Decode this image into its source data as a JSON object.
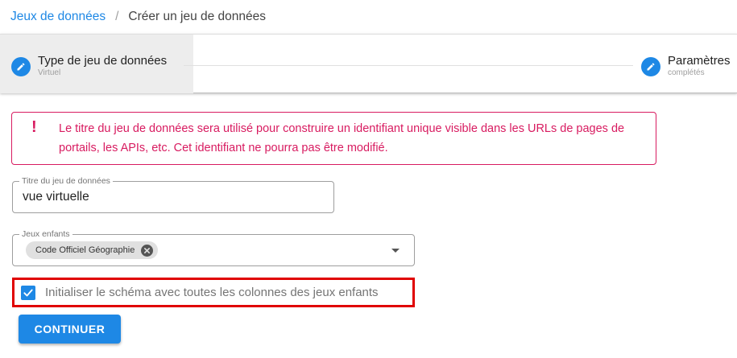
{
  "breadcrumb": {
    "link_label": "Jeux de données",
    "separator": "/",
    "current_label": "Créer un jeu de données"
  },
  "stepper": {
    "steps": [
      {
        "title": "Type de jeu de données",
        "subtitle": "Virtuel",
        "icon": "pencil-icon",
        "active": true
      },
      {
        "title": "Paramètres",
        "subtitle": "complétés",
        "icon": "pencil-icon",
        "active": false
      }
    ]
  },
  "alert": {
    "icon": "!",
    "text": "Le titre du jeu de données sera utilisé pour construire un identifiant unique visible dans les URLs de pages de portails, les APIs, etc. Cet identifiant ne pourra pas être modifié."
  },
  "form": {
    "title_field": {
      "label": "Titre du jeu de données",
      "value": "vue virtuelle"
    },
    "children_field": {
      "label": "Jeux enfants",
      "chips": [
        "Code Officiel Géographie"
      ]
    },
    "init_schema_checkbox": {
      "label": "Initialiser le schéma avec toutes les colonnes des jeux enfants",
      "checked": true
    },
    "continue_button": {
      "label": "CONTINUER"
    }
  },
  "colors": {
    "primary": "#1e88e5",
    "alert": "#d81b60",
    "highlight_border": "#e00000"
  }
}
